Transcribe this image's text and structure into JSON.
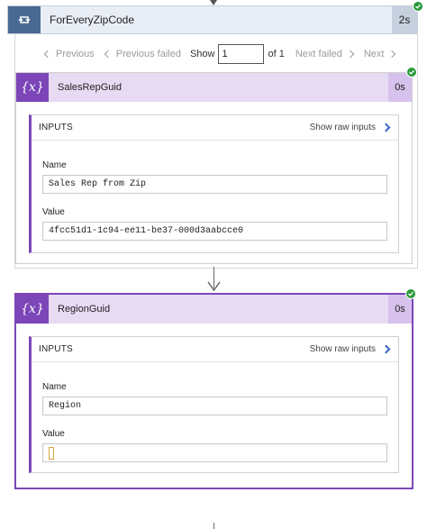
{
  "loop": {
    "title": "ForEveryZipCode",
    "duration": "2s"
  },
  "pager": {
    "previous": "Previous",
    "previous_failed": "Previous failed",
    "show": "Show",
    "current_page": "1",
    "of": "of 1",
    "next_failed": "Next failed",
    "next": "Next"
  },
  "actions": [
    {
      "title": "SalesRepGuid",
      "duration": "0s",
      "inputs_label": "INPUTS",
      "show_raw": "Show raw inputs",
      "fields": [
        {
          "label": "Name",
          "value": "Sales Rep from Zip"
        },
        {
          "label": "Value",
          "value": "4fcc51d1-1c94-ee11-be37-000d3aabcce0"
        }
      ]
    },
    {
      "title": "RegionGuid",
      "duration": "0s",
      "inputs_label": "INPUTS",
      "show_raw": "Show raw inputs",
      "fields": [
        {
          "label": "Name",
          "value": "Region"
        },
        {
          "label": "Value",
          "value": ""
        }
      ]
    }
  ],
  "icons": {
    "loop": "loop-icon",
    "variable": "variable-icon",
    "check": "check-icon"
  },
  "colors": {
    "loop_accent": "#486991",
    "variable_accent": "#7c46b8",
    "success": "#2b9a3a",
    "link_chevron": "#3b66c4"
  }
}
